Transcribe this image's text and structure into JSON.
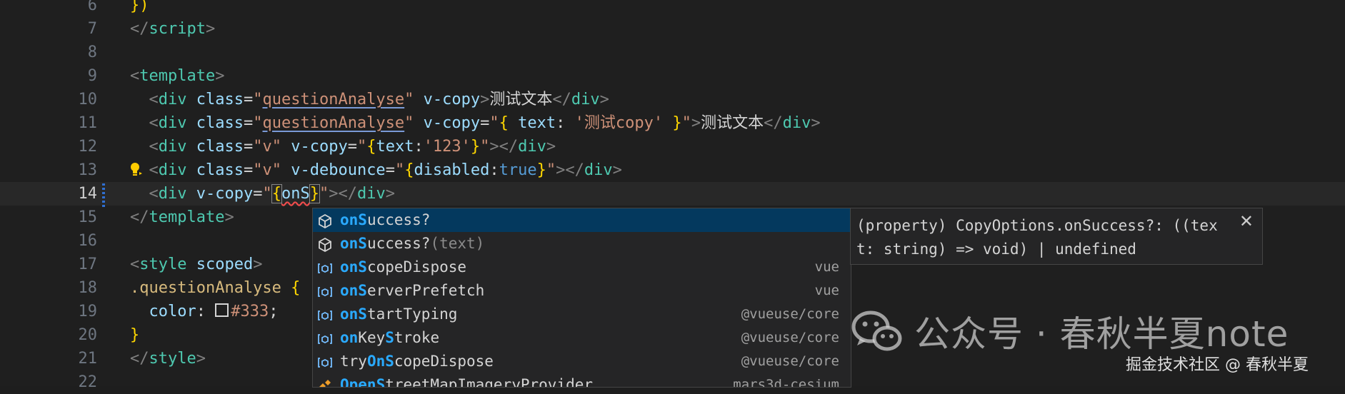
{
  "editor": {
    "lines": [
      {
        "num": "6",
        "parts": [
          {
            "t": "})",
            "c": "br"
          }
        ]
      },
      {
        "num": "7",
        "parts": [
          {
            "t": "</",
            "c": "pu"
          },
          {
            "t": "script",
            "c": "tg"
          },
          {
            "t": ">",
            "c": "pu"
          }
        ]
      },
      {
        "num": "8",
        "parts": []
      },
      {
        "num": "9",
        "parts": [
          {
            "t": "<",
            "c": "pu"
          },
          {
            "t": "template",
            "c": "tg"
          },
          {
            "t": ">",
            "c": "pu"
          }
        ]
      },
      {
        "num": "10",
        "parts": [
          {
            "t": "  <",
            "c": "pu"
          },
          {
            "t": "div",
            "c": "tg"
          },
          {
            "t": " class",
            "c": "at"
          },
          {
            "t": "=",
            "c": "eq"
          },
          {
            "t": "\"",
            "c": "st"
          },
          {
            "t": "questionAnalyse",
            "c": "st ul"
          },
          {
            "t": "\"",
            "c": "st"
          },
          {
            "t": " v-copy",
            "c": "at"
          },
          {
            "t": ">",
            "c": "pu"
          },
          {
            "t": "测试文本",
            "c": "eq"
          },
          {
            "t": "</",
            "c": "pu"
          },
          {
            "t": "div",
            "c": "tg"
          },
          {
            "t": ">",
            "c": "pu"
          }
        ]
      },
      {
        "num": "11",
        "parts": [
          {
            "t": "  <",
            "c": "pu"
          },
          {
            "t": "div",
            "c": "tg"
          },
          {
            "t": " class",
            "c": "at"
          },
          {
            "t": "=",
            "c": "eq"
          },
          {
            "t": "\"",
            "c": "st"
          },
          {
            "t": "questionAnalyse",
            "c": "st ul"
          },
          {
            "t": "\"",
            "c": "st"
          },
          {
            "t": " v-copy",
            "c": "at"
          },
          {
            "t": "=",
            "c": "eq"
          },
          {
            "t": "\"",
            "c": "st"
          },
          {
            "t": "{",
            "c": "br"
          },
          {
            "t": " text",
            "c": "at"
          },
          {
            "t": ": ",
            "c": "eq"
          },
          {
            "t": "'测试copy'",
            "c": "st"
          },
          {
            "t": " }",
            "c": "br"
          },
          {
            "t": "\"",
            "c": "st"
          },
          {
            "t": ">",
            "c": "pu"
          },
          {
            "t": "测试文本",
            "c": "eq"
          },
          {
            "t": "</",
            "c": "pu"
          },
          {
            "t": "div",
            "c": "tg"
          },
          {
            "t": ">",
            "c": "pu"
          }
        ]
      },
      {
        "num": "12",
        "parts": [
          {
            "t": "  <",
            "c": "pu"
          },
          {
            "t": "div",
            "c": "tg"
          },
          {
            "t": " class",
            "c": "at"
          },
          {
            "t": "=",
            "c": "eq"
          },
          {
            "t": "\"v\"",
            "c": "st"
          },
          {
            "t": " v-copy",
            "c": "at"
          },
          {
            "t": "=",
            "c": "eq"
          },
          {
            "t": "\"",
            "c": "st"
          },
          {
            "t": "{",
            "c": "br"
          },
          {
            "t": "text",
            "c": "at"
          },
          {
            "t": ":",
            "c": "eq"
          },
          {
            "t": "'123'",
            "c": "st"
          },
          {
            "t": "}",
            "c": "br"
          },
          {
            "t": "\"",
            "c": "st"
          },
          {
            "t": "></",
            "c": "pu"
          },
          {
            "t": "div",
            "c": "tg"
          },
          {
            "t": ">",
            "c": "pu"
          }
        ]
      },
      {
        "num": "13",
        "parts": [
          {
            "t": "  <",
            "c": "pu"
          },
          {
            "t": "div",
            "c": "tg"
          },
          {
            "t": " class",
            "c": "at"
          },
          {
            "t": "=",
            "c": "eq"
          },
          {
            "t": "\"v\"",
            "c": "st"
          },
          {
            "t": " v-debounce",
            "c": "at"
          },
          {
            "t": "=",
            "c": "eq"
          },
          {
            "t": "\"",
            "c": "st"
          },
          {
            "t": "{",
            "c": "br"
          },
          {
            "t": "disabled",
            "c": "at"
          },
          {
            "t": ":",
            "c": "eq"
          },
          {
            "t": "true",
            "c": "bl"
          },
          {
            "t": "}",
            "c": "br"
          },
          {
            "t": "\"",
            "c": "st"
          },
          {
            "t": "></",
            "c": "pu"
          },
          {
            "t": "div",
            "c": "tg"
          },
          {
            "t": ">",
            "c": "pu"
          }
        ]
      },
      {
        "num": "14",
        "current": true,
        "parts": [
          {
            "t": "  <",
            "c": "pu"
          },
          {
            "t": "div",
            "c": "tg"
          },
          {
            "t": " v-copy",
            "c": "at"
          },
          {
            "t": "=",
            "c": "eq"
          },
          {
            "t": "\"",
            "c": "st"
          },
          {
            "t": "{",
            "c": "br cursor-box"
          },
          {
            "t": "onS",
            "c": "at squig"
          },
          {
            "t": "}",
            "c": "br cursor-box"
          },
          {
            "t": "\"",
            "c": "st"
          },
          {
            "t": "></",
            "c": "pu"
          },
          {
            "t": "div",
            "c": "tg"
          },
          {
            "t": ">",
            "c": "pu"
          }
        ]
      },
      {
        "num": "15",
        "parts": [
          {
            "t": "</",
            "c": "pu"
          },
          {
            "t": "template",
            "c": "tg"
          },
          {
            "t": ">",
            "c": "pu"
          }
        ]
      },
      {
        "num": "16",
        "parts": []
      },
      {
        "num": "17",
        "parts": [
          {
            "t": "<",
            "c": "pu"
          },
          {
            "t": "style",
            "c": "tg"
          },
          {
            "t": " scoped",
            "c": "at"
          },
          {
            "t": ">",
            "c": "pu"
          }
        ]
      },
      {
        "num": "18",
        "parts": [
          {
            "t": ".questionAnalyse",
            "c": "cssel"
          },
          {
            "t": " {",
            "c": "br"
          }
        ]
      },
      {
        "num": "19",
        "parts": [
          {
            "t": "  color",
            "c": "cssprop"
          },
          {
            "t": ": ",
            "c": "eq"
          },
          {
            "t": "",
            "c": "swatch"
          },
          {
            "t": "#333",
            "c": "csval"
          },
          {
            "t": ";",
            "c": "eq"
          }
        ]
      },
      {
        "num": "20",
        "parts": [
          {
            "t": "}",
            "c": "br"
          }
        ]
      },
      {
        "num": "21",
        "parts": [
          {
            "t": "</",
            "c": "pu"
          },
          {
            "t": "style",
            "c": "tg"
          },
          {
            "t": ">",
            "c": "pu"
          }
        ]
      },
      {
        "num": "22",
        "parts": []
      }
    ]
  },
  "suggest": {
    "items": [
      {
        "icon": "property-icon",
        "hl": "onS",
        "rest": "uccess?",
        "dim": "",
        "detail": "",
        "selected": true
      },
      {
        "icon": "property-icon",
        "hl": "onS",
        "rest": "uccess?",
        "dim": "(text)",
        "detail": "",
        "selected": false
      },
      {
        "icon": "variable-icon",
        "hl": "onS",
        "rest": "copeDispose",
        "dim": "",
        "detail": "vue",
        "selected": false
      },
      {
        "icon": "variable-icon",
        "hl": "onS",
        "rest": "erverPrefetch",
        "dim": "",
        "detail": "vue",
        "selected": false
      },
      {
        "icon": "variable-icon",
        "hl": "onS",
        "rest": "tartTyping",
        "dim": "",
        "detail": "@vueuse/core",
        "selected": false
      },
      {
        "icon": "variable-icon",
        "pre": "",
        "hl": "on",
        "mid": "Key",
        "hl2": "S",
        "rest": "troke",
        "dim": "",
        "detail": "@vueuse/core",
        "selected": false
      },
      {
        "icon": "variable-icon",
        "pre": "try",
        "hl": "OnS",
        "rest": "copeDispose",
        "dim": "",
        "detail": "@vueuse/core",
        "selected": false
      },
      {
        "icon": "class-icon",
        "pre": "",
        "hl": "OpenS",
        "rest": "treetMapImageryProvider",
        "dim": "",
        "detail": "mars3d-cesium",
        "selected": false
      }
    ]
  },
  "details": {
    "text": "(property) CopyOptions.onSuccess?: ((text: string) => void) | undefined",
    "close_label": "✕"
  },
  "watermark": {
    "main": "公众号 · 春秋半夏note",
    "sub": "掘金技术社区 @ 春秋半夏"
  }
}
